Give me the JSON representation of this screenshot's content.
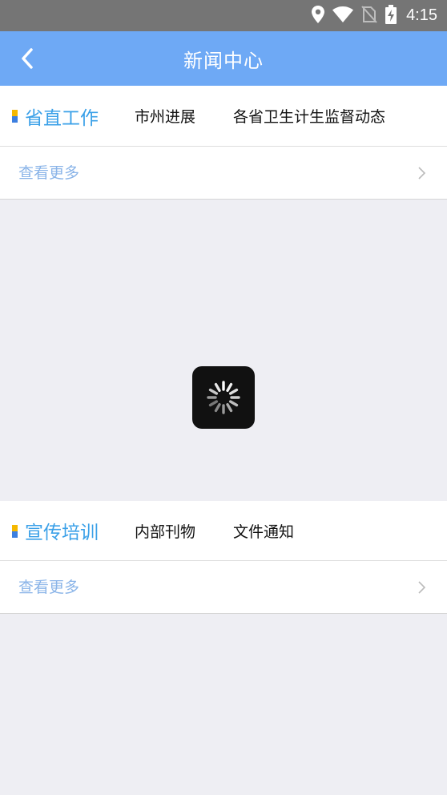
{
  "status_bar": {
    "time": "4:15",
    "icons": [
      "location-icon",
      "wifi-icon",
      "no-sim-icon",
      "battery-charging-icon"
    ]
  },
  "app_bar": {
    "title": "新闻中心",
    "back_icon": "back-arrow-icon"
  },
  "sections": [
    {
      "active_tab": "省直工作",
      "tabs": [
        "市州进展",
        "各省卫生计生监督动态"
      ],
      "more_label": "查看更多"
    },
    {
      "active_tab": "宣传培训",
      "tabs": [
        "内部刊物",
        "文件通知"
      ],
      "more_label": "查看更多"
    }
  ],
  "colors": {
    "app_bar": "#6ea9f5",
    "active_tab": "#3aa0e8",
    "more_label": "#8ab4e8",
    "marker_top": "#f5b800",
    "marker_bottom": "#3c7fe0",
    "background": "#eeeef3"
  },
  "loading_indicator": "spinner-icon"
}
